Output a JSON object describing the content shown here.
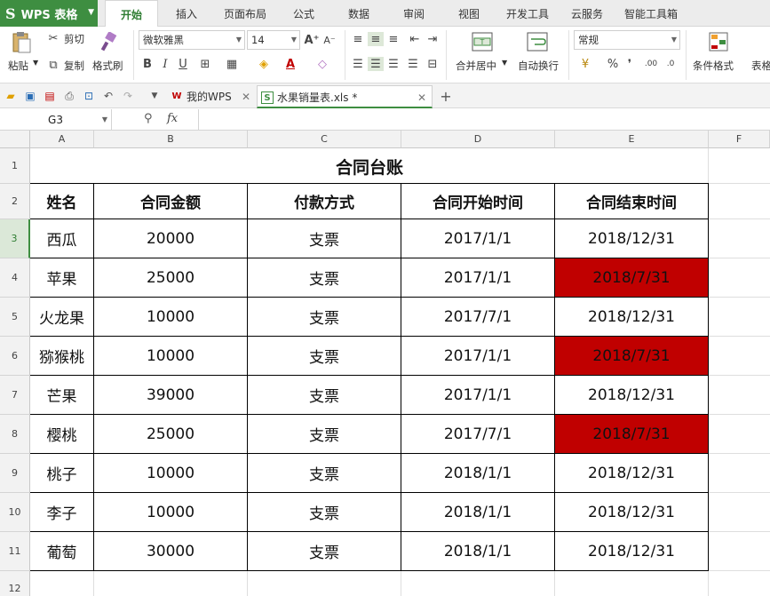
{
  "app": {
    "name": "WPS 表格",
    "logo": "S"
  },
  "menu": [
    "开始",
    "插入",
    "页面布局",
    "公式",
    "数据",
    "审阅",
    "视图",
    "开发工具",
    "云服务",
    "智能工具箱"
  ],
  "ribbon": {
    "paste": "粘贴",
    "cut": "剪切",
    "copy": "复制",
    "format_painter": "格式刷",
    "font_name": "微软雅黑",
    "font_size": "14",
    "merge_center": "合并居中",
    "wrap_text": "自动换行",
    "number_format": "常规",
    "cond_format": "条件格式",
    "table_style": "表格"
  },
  "tabs": [
    {
      "label": "我的WPS",
      "icon": "W"
    },
    {
      "label": "水果销量表.xls *",
      "icon": "S"
    }
  ],
  "formula_bar": {
    "cell_ref": "G3",
    "fx": "fx"
  },
  "columns": [
    "A",
    "B",
    "C",
    "D",
    "E",
    "F"
  ],
  "rows": [
    "1",
    "2",
    "3",
    "4",
    "5",
    "6",
    "7",
    "8",
    "9",
    "10",
    "11",
    "12"
  ],
  "sheet": {
    "title": "合同台账",
    "headers": [
      "姓名",
      "合同金额",
      "付款方式",
      "合同开始时间",
      "合同结束时间"
    ],
    "data": [
      [
        "西瓜",
        "20000",
        "支票",
        "2017/1/1",
        "2018/12/31"
      ],
      [
        "苹果",
        "25000",
        "支票",
        "2017/1/1",
        "2018/7/31"
      ],
      [
        "火龙果",
        "10000",
        "支票",
        "2017/7/1",
        "2018/12/31"
      ],
      [
        "猕猴桃",
        "10000",
        "支票",
        "2017/1/1",
        "2018/7/31"
      ],
      [
        "芒果",
        "39000",
        "支票",
        "2017/1/1",
        "2018/12/31"
      ],
      [
        "樱桃",
        "25000",
        "支票",
        "2017/7/1",
        "2018/7/31"
      ],
      [
        "桃子",
        "10000",
        "支票",
        "2018/1/1",
        "2018/12/31"
      ],
      [
        "李子",
        "10000",
        "支票",
        "2018/1/1",
        "2018/12/31"
      ],
      [
        "葡萄",
        "30000",
        "支票",
        "2018/1/1",
        "2018/12/31"
      ]
    ],
    "highlight_rows": [
      1,
      3,
      5
    ],
    "highlight_color": "#c00000"
  },
  "colors": {
    "accent": "#3e8e41",
    "highlight": "#c00000"
  }
}
